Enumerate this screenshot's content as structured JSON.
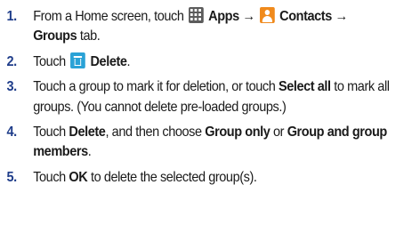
{
  "steps": [
    {
      "number": "1.",
      "prefix": "From a Home screen, touch ",
      "apps": "Apps",
      "arrow1": " → ",
      "contacts": "Contacts",
      "arrow2": " →",
      "groups_tab": "Groups",
      "suffix": " tab."
    },
    {
      "number": "2.",
      "prefix": "Touch ",
      "delete": "Delete",
      "suffix": "."
    },
    {
      "number": "3.",
      "prefix": "Touch a group to mark it for deletion, or touch ",
      "select_all": "Select all",
      "suffix": " to mark all groups. (You cannot delete pre-loaded groups.)"
    },
    {
      "number": "4.",
      "prefix": "Touch ",
      "delete": "Delete",
      "middle": ", and then choose ",
      "group_only": "Group only",
      "or": " or ",
      "group_and_members": "Group and group members",
      "suffix": "."
    },
    {
      "number": "5.",
      "prefix": "Touch ",
      "ok": "OK",
      "suffix": " to delete the selected group(s)."
    }
  ],
  "icons": {
    "apps": "apps-grid-icon",
    "contacts": "contacts-person-icon",
    "delete": "trash-icon"
  },
  "colors": {
    "step_number": "#1f3d8a",
    "contacts_icon": "#f08a1c",
    "delete_icon": "#2aa2d6"
  }
}
